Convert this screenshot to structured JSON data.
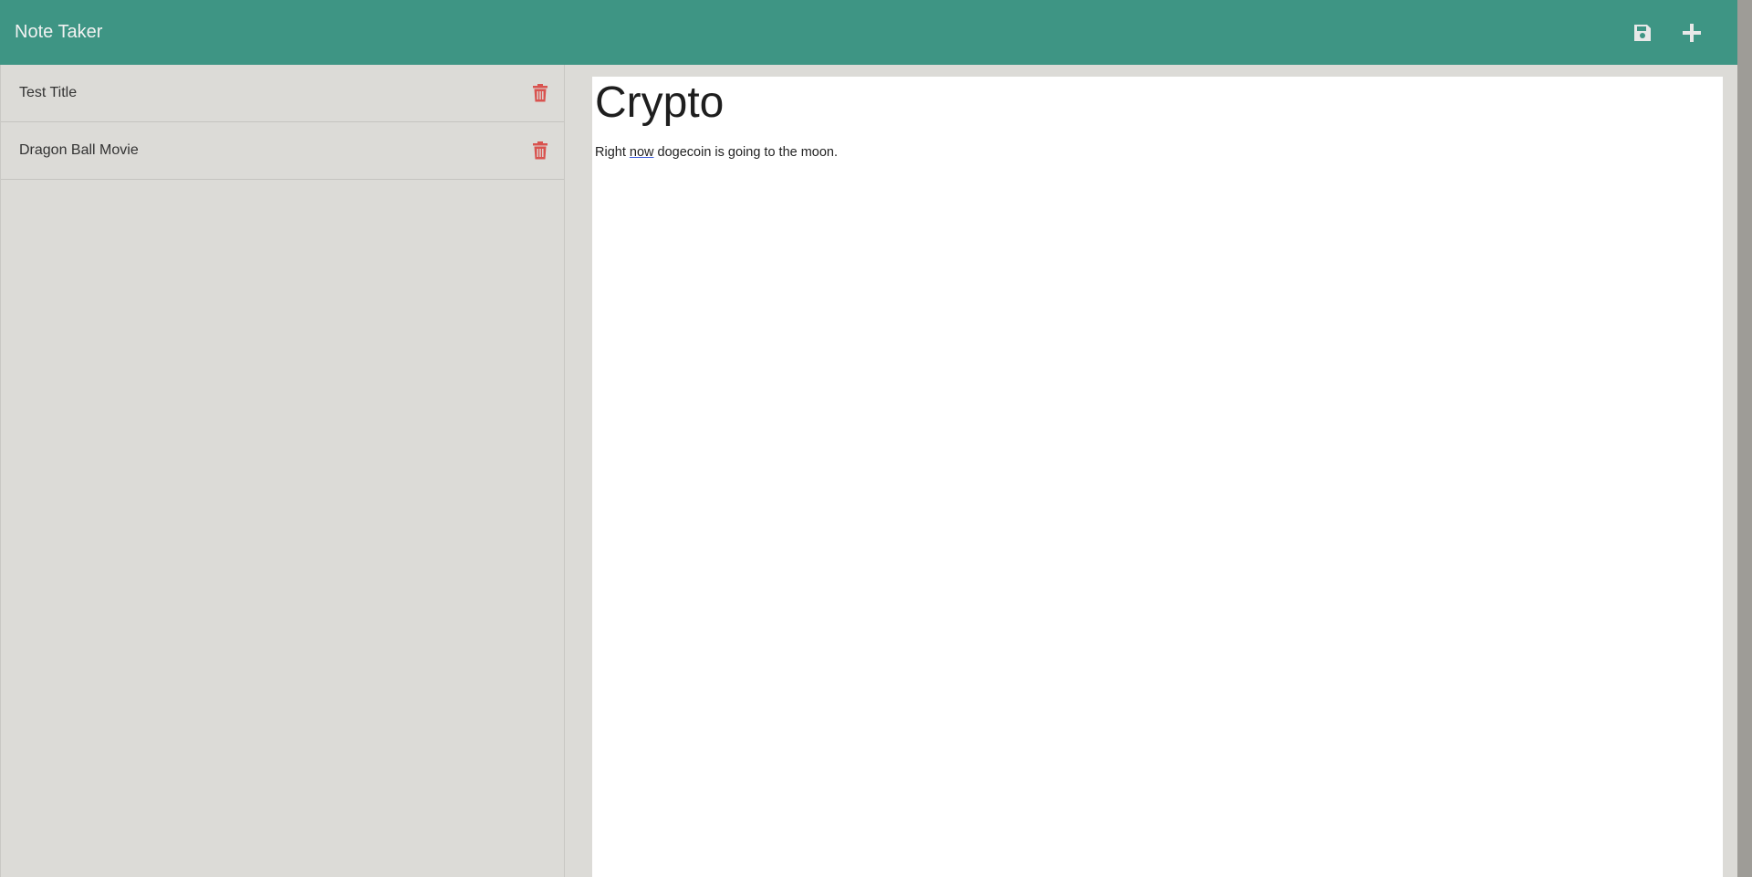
{
  "header": {
    "title": "Note Taker",
    "save_icon": "save-icon",
    "add_icon": "plus-icon"
  },
  "notes": [
    {
      "title": "Test Title"
    },
    {
      "title": "Dragon Ball Movie"
    }
  ],
  "active_note": {
    "title": "Crypto",
    "text_before": "Right ",
    "text_flagged": "now",
    "text_after": " dogecoin is going to the moon."
  },
  "colors": {
    "navbar": "#3e9584",
    "sidebar": "#dcdbd7",
    "delete": "#d9534f",
    "nav_icon": "#e8e8e8"
  }
}
